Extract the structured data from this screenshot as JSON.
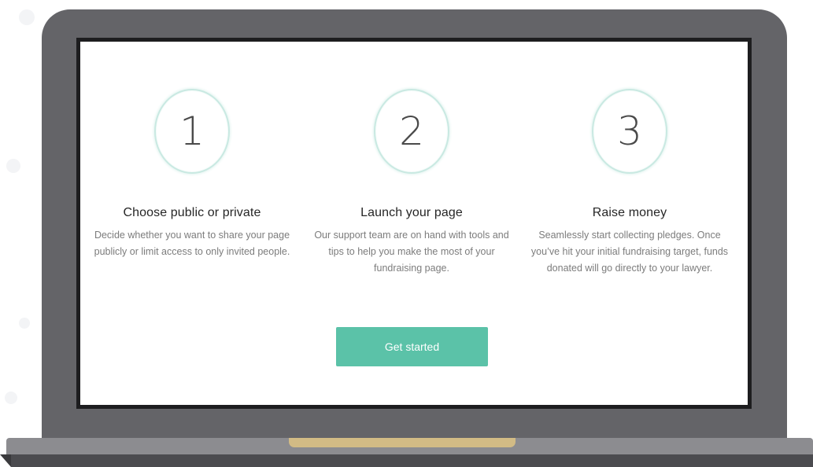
{
  "steps": [
    {
      "number": "1",
      "title": "Choose public or private",
      "description": "Decide whether you want to share your page publicly or limit access to only invited people."
    },
    {
      "number": "2",
      "title": "Launch your page",
      "description": "Our support team are on hand with tools and tips to help you make the most of your fundraising page."
    },
    {
      "number": "3",
      "title": "Raise money",
      "description": "Seamlessly start collecting pledges. Once you’ve hit your initial fundraising target, funds donated will go directly to your lawyer."
    }
  ],
  "cta": {
    "label": "Get started"
  },
  "colors": {
    "accent": "#5bc2a8",
    "circle_border": "#c9e9e2",
    "laptop_body": "#646468",
    "laptop_base": "#8c8c90",
    "laptop_notch": "#d2bb85"
  }
}
